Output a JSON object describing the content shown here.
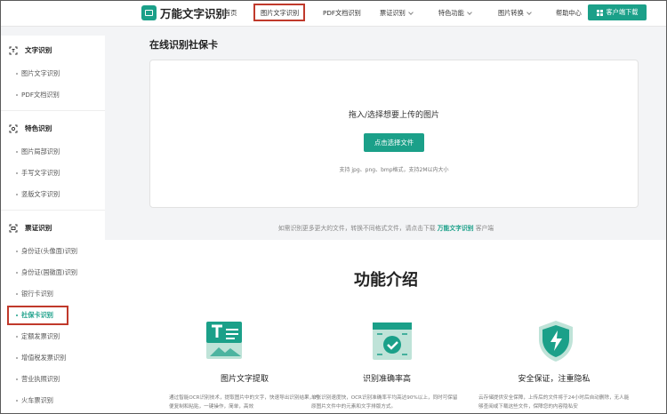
{
  "header": {
    "brand": "万能文字识别",
    "nav": [
      {
        "label": "首页",
        "dropdown": false
      },
      {
        "label": "图片文字识别",
        "dropdown": false,
        "active": true
      },
      {
        "label": "PDF文档识别",
        "dropdown": false
      },
      {
        "label": "票证识别",
        "dropdown": true
      },
      {
        "label": "特色功能",
        "dropdown": true
      },
      {
        "label": "图片转换",
        "dropdown": true
      },
      {
        "label": "帮助中心",
        "dropdown": false
      }
    ],
    "download_label": "客户端下载"
  },
  "sidebar": {
    "sections": [
      {
        "title": "文字识别",
        "icon": "text-recognition-icon",
        "items": [
          "图片文字识别",
          "PDF文档识别"
        ]
      },
      {
        "title": "特色识别",
        "icon": "scan-icon",
        "items": [
          "图片局部识别",
          "手写文字识别",
          "竖版文字识别"
        ]
      },
      {
        "title": "票证识别",
        "icon": "ticket-icon",
        "items": [
          "身份证(头像面)识别",
          "身份证(国徽面)识别",
          "银行卡识别",
          "社保卡识别",
          "定额发票识别",
          "增值税发票识别",
          "营业执照识别",
          "火车票识别"
        ]
      }
    ],
    "active_item": "社保卡识别"
  },
  "main": {
    "title": "在线识别社保卡",
    "upload_prompt": "拖入/选择想要上传的图片",
    "upload_button": "点击选择文件",
    "upload_hint": "支持 jpg、png、bmp格式，支持2M以内大小",
    "tip_prefix": "如需识别更多更大的文件，转换不同格式文件，请点击下载",
    "tip_link": "万能文字识别",
    "tip_suffix": "客户端"
  },
  "features": {
    "title": "功能介绍",
    "items": [
      {
        "icon": "image-text-icon",
        "title": "图片文字提取",
        "desc": "通过智能OCR识别技术，提取图片中的文字，快速导出识别结果，方便复制和粘贴，一键操作，简单，高效"
      },
      {
        "icon": "accuracy-check-icon",
        "title": "识别准确率高",
        "desc": "单张识别速度快，OCR识别准确率平均高达90%以上，同时可保留原图片文件中的元素和文字排版方式。"
      },
      {
        "icon": "shield-lightning-icon",
        "title": "安全保证，注重隐私",
        "desc": "云存储提供安全保障，上传后的文件将于24小时后自动删除，无人能够查阅或下载这些文件，保障您的内容隐私安"
      }
    ]
  },
  "colors": {
    "accent": "#1ba089",
    "highlight_border": "#c0392b"
  }
}
